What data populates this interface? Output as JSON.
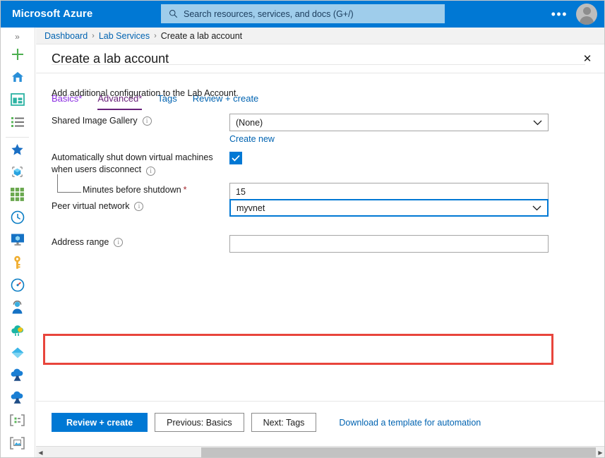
{
  "topbar": {
    "brand": "Microsoft Azure",
    "search": {
      "placeholder": "Search resources, services, and docs (G+/)",
      "icon": "search-icon"
    },
    "ellipsis": "•••",
    "avatar_icon": "user-avatar-icon",
    "accent_color": "#0078d4",
    "search_bg": "#9fcdeb"
  },
  "rail": {
    "collapse_icon": "»",
    "items": [
      {
        "name": "create-a-resource",
        "icon": "plus-icon",
        "color": "#4caf50"
      },
      {
        "name": "home",
        "icon": "home-icon",
        "color": "#0078d4"
      },
      {
        "name": "dashboard",
        "icon": "dashboard-icon",
        "color": "#2bb3a3"
      },
      {
        "name": "all-services",
        "icon": "list-icon",
        "color": "#5bb75b"
      },
      {
        "name": "favorites",
        "icon": "star-icon",
        "color": "#1a6fc4"
      },
      {
        "name": "all-resources",
        "icon": "resource-cube-icon",
        "color": "#2196f3"
      },
      {
        "name": "resource-groups",
        "icon": "grid-icon",
        "color": "#6aa84f"
      },
      {
        "name": "recent",
        "icon": "clock-icon",
        "color": "#0a7dc4"
      },
      {
        "name": "virtual-machines",
        "icon": "monitor-icon",
        "color": "#0078d4"
      },
      {
        "name": "key-vaults",
        "icon": "key-icon",
        "color": "#f0ad2e"
      },
      {
        "name": "monitor",
        "icon": "gauge-icon",
        "color": "#0a7dc4"
      },
      {
        "name": "support",
        "icon": "support-person-icon",
        "color": "#2196f3"
      },
      {
        "name": "cost-management",
        "icon": "cloud-coin-icon",
        "color": "#19b5a5"
      },
      {
        "name": "app-services",
        "icon": "diamond-icon",
        "color": "#4fc3f7"
      },
      {
        "name": "lab-services",
        "icon": "cloud-flask-icon",
        "color": "#1976d2"
      },
      {
        "name": "lab-accounts",
        "icon": "cloud-flask-icon",
        "color": "#1976d2"
      },
      {
        "name": "templates",
        "icon": "template-icon",
        "color": "#757575"
      },
      {
        "name": "images",
        "icon": "image-icon",
        "color": "#757575"
      }
    ]
  },
  "breadcrumb": {
    "items": [
      {
        "label": "Dashboard",
        "link": true
      },
      {
        "label": "Lab Services",
        "link": true
      },
      {
        "label": "Create a lab account",
        "link": false
      }
    ],
    "separator": "›"
  },
  "blade": {
    "title": "Create a lab account",
    "close_label": "✕"
  },
  "tabs": [
    {
      "label": "Basics",
      "required_mark": "*",
      "state": "dirty"
    },
    {
      "label": "Advanced",
      "required_mark": "*",
      "state": "active"
    },
    {
      "label": "Tags",
      "required_mark": "",
      "state": "normal"
    },
    {
      "label": "Review + create",
      "required_mark": "",
      "state": "normal"
    }
  ],
  "form": {
    "intro": "Add additional configuration to the Lab Account.",
    "shared_image_gallery": {
      "label": "Shared Image Gallery",
      "info_icon": "info-icon",
      "value": "(None)",
      "chevron": "⌄",
      "create_new_link": "Create new"
    },
    "auto_shutdown": {
      "label_line1": "Automatically shut down virtual machines",
      "label_line2": "when users disconnect",
      "info_icon": "info-icon",
      "checked": true,
      "check_glyph": "✓"
    },
    "minutes_before_shutdown": {
      "label": "Minutes before shutdown",
      "required_mark": "*",
      "value": "15"
    },
    "peer_virtual_network": {
      "label": "Peer virtual network",
      "info_icon": "info-icon",
      "value": "myvnet",
      "chevron": "⌄",
      "focused": true,
      "highlight_color": "#e8453c"
    },
    "address_range": {
      "label": "Address range",
      "info_icon": "info-icon",
      "value": "",
      "placeholder": ""
    }
  },
  "footer": {
    "review_create": "Review + create",
    "previous": "Previous: Basics",
    "next": "Next: Tags",
    "download_template": "Download a template for automation"
  },
  "scrollbar": {
    "left_arrow": "◀",
    "right_arrow": "▶"
  }
}
